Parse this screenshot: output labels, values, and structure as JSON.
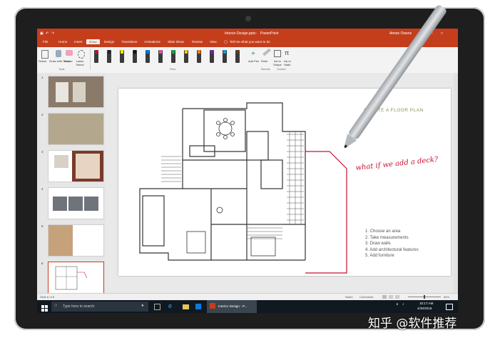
{
  "window": {
    "title": "Interior Design.pptx",
    "app": "PowerPoint",
    "user": "Aimee Owens",
    "tell_me": "Tell me what you want to do"
  },
  "tabs": [
    "File",
    "Home",
    "Insert",
    "Draw",
    "Design",
    "Transitions",
    "Animations",
    "Slide Show",
    "Review",
    "View"
  ],
  "active_tab": "Draw",
  "ribbon": {
    "select": "Select",
    "draw_touch": "Draw with Touch",
    "eraser": "Eraser",
    "lasso_select": "Lasso Select",
    "tools_group": "Tools",
    "pens_group": "Pens",
    "add_pen": "Add Pen",
    "ruler": "Ruler",
    "ink_to_shape": "Ink to Shape",
    "ink_to_math": "Ink to Math",
    "stencils_group": "Stencils",
    "convert_group": "Convert",
    "pen_colors": [
      "#c8102e",
      "#222222",
      "#f2e600",
      "#111111",
      "#0a7bd8",
      "#e84bb7",
      "#1aa34a",
      "#f7c600",
      "#ff7a00",
      "#7b1fa2",
      "#00a3d9",
      "#5a3e2b"
    ]
  },
  "thumbnails": [
    {
      "num": "1"
    },
    {
      "num": "2"
    },
    {
      "num": "3"
    },
    {
      "num": "4"
    },
    {
      "num": "5"
    },
    {
      "num": "6"
    }
  ],
  "slide": {
    "title": "CREATE A FLOOR PLAN",
    "ink_text": "what if we add a deck?",
    "steps": [
      "1. Choose an area",
      "2. Take measurements",
      "3. Draw walls",
      "4. Add architectural features",
      "5. Add furniture"
    ]
  },
  "status": {
    "slide_of": "Slide 6 of 8",
    "notes": "Notes",
    "comments": "Comments",
    "zoom": "65%"
  },
  "taskbar": {
    "search_placeholder": "Type here to search",
    "active_app": "Interior Design - P...",
    "time": "10:17 AM",
    "date": "4/30/2018"
  },
  "watermark": "知乎 @软件推荐"
}
